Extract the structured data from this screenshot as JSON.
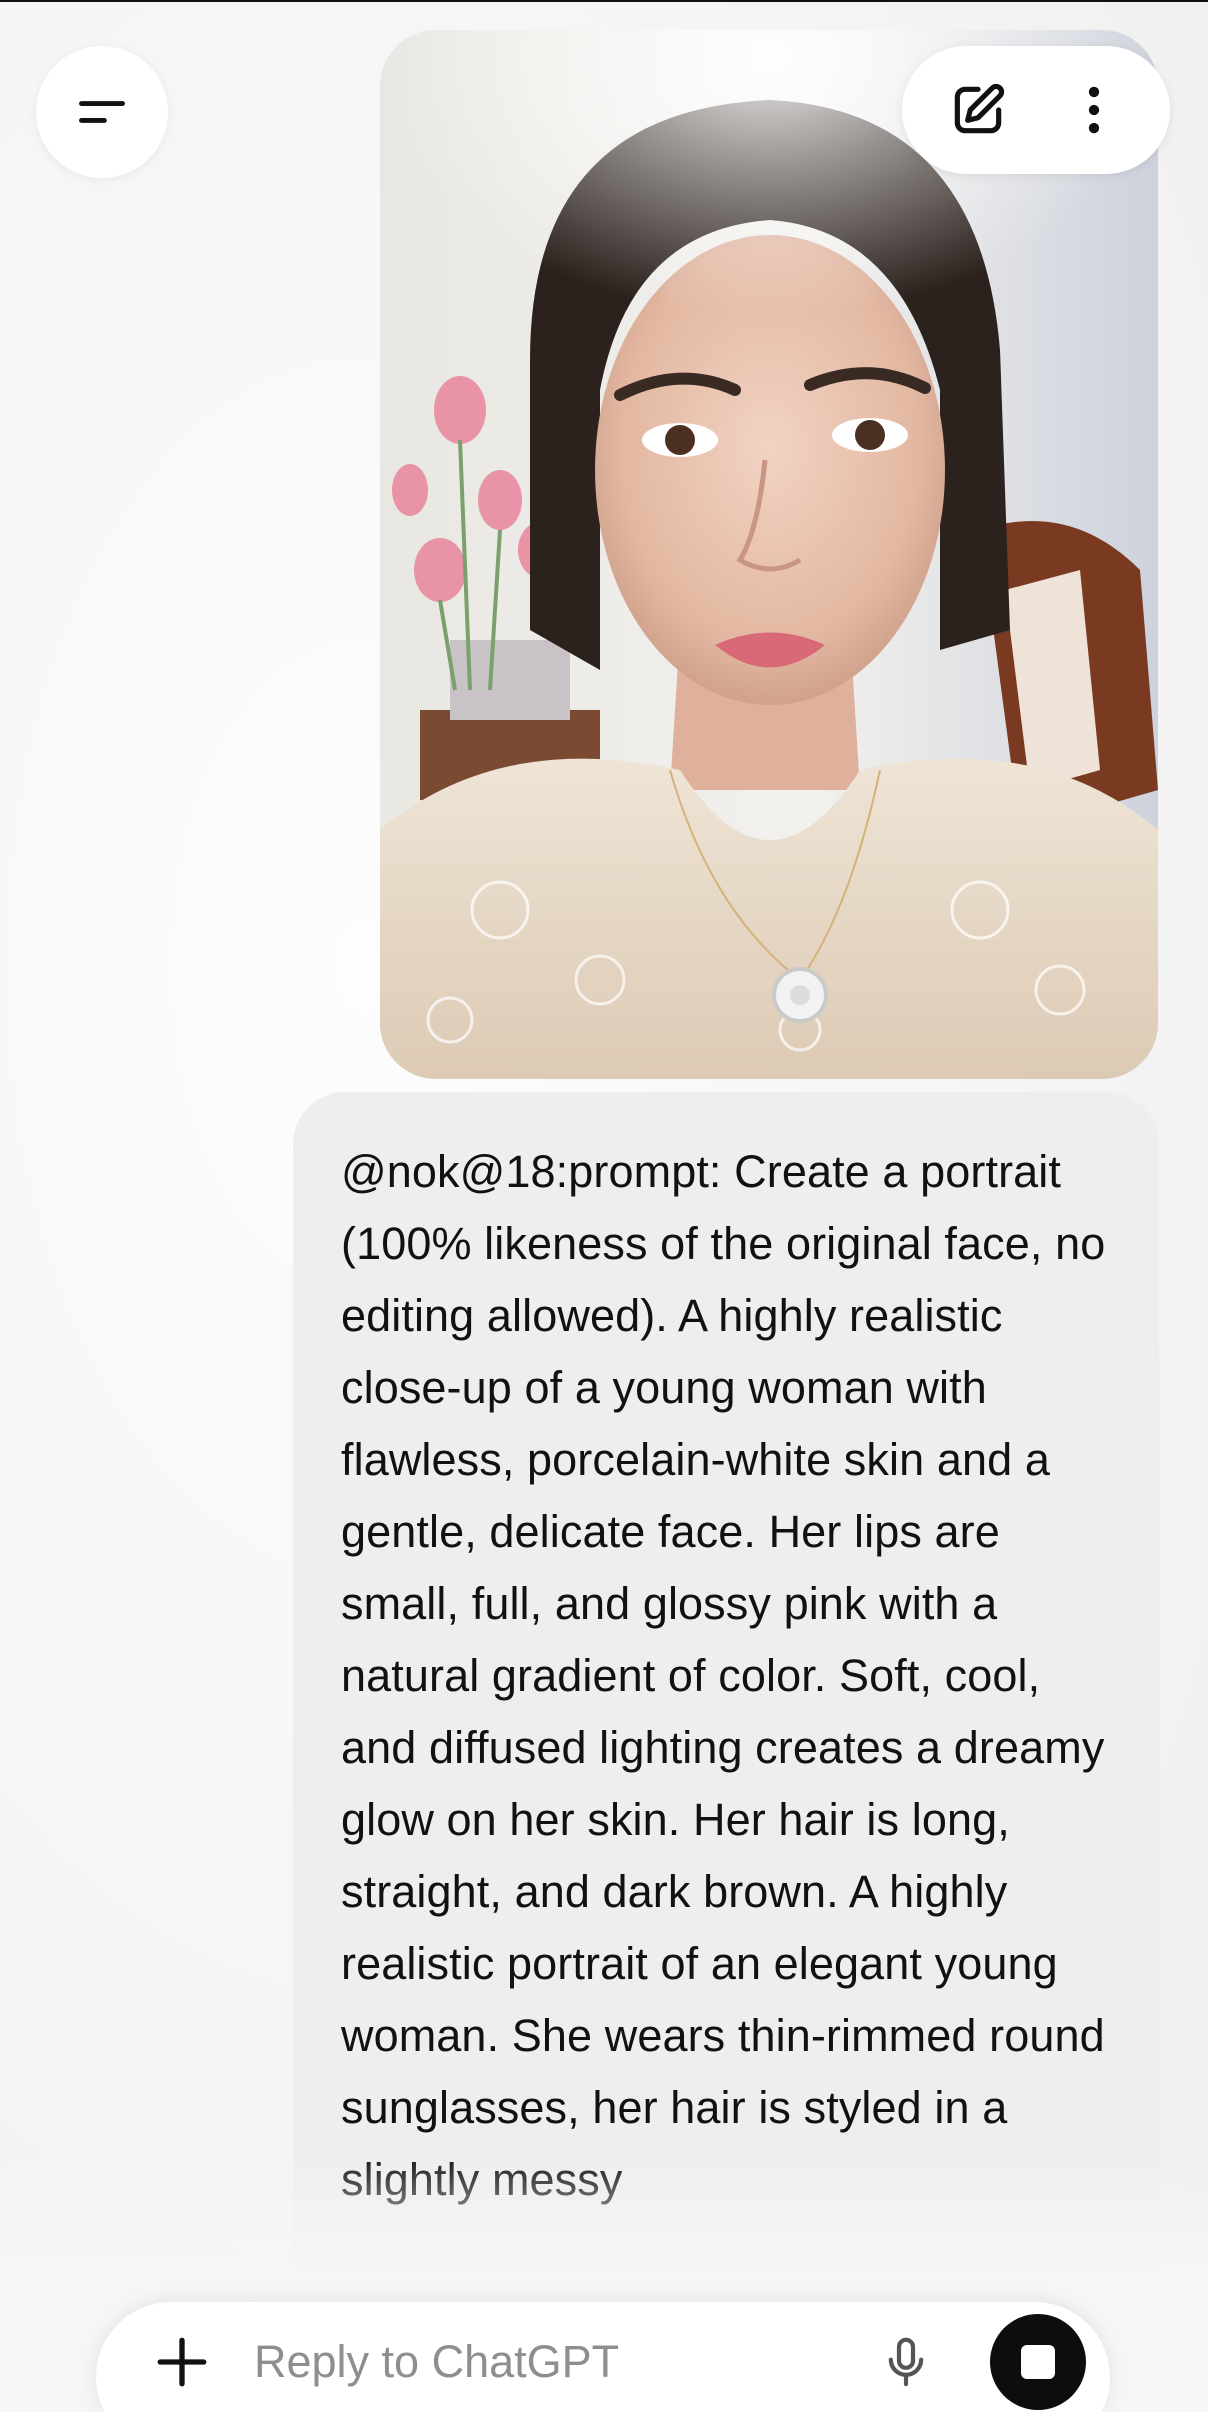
{
  "header": {
    "menu_icon": "menu-lines-icon",
    "new_chat_icon": "edit-pencil-icon",
    "more_icon": "vertical-dots-icon"
  },
  "attachment": {
    "type": "photo",
    "subject": "portrait"
  },
  "message": {
    "text": "@nok@18:prompt: Create a portrait (100% likeness of the original face, no editing allowed). A highly realistic close-up of a young woman with flawless, porcelain-white skin and a gentle, delicate face. Her lips are small, full, and glossy pink with a natural gradient of color. Soft, cool, and diffused lighting creates a dreamy glow on her skin. Her hair is long, straight, and dark brown. A highly realistic portrait of an elegant young woman. She wears thin-rimmed round sunglasses, her hair is styled in a slightly messy"
  },
  "composer": {
    "placeholder": "Reply to ChatGPT",
    "value": "",
    "plus_icon": "plus-icon",
    "mic_icon": "microphone-icon",
    "stop_icon": "stop-icon"
  },
  "colors": {
    "background": "#f4f4f4",
    "bubble": "#eeeeee",
    "text": "#111111",
    "placeholder": "#8e8e8e",
    "stop_button": "#0d0d0d"
  }
}
